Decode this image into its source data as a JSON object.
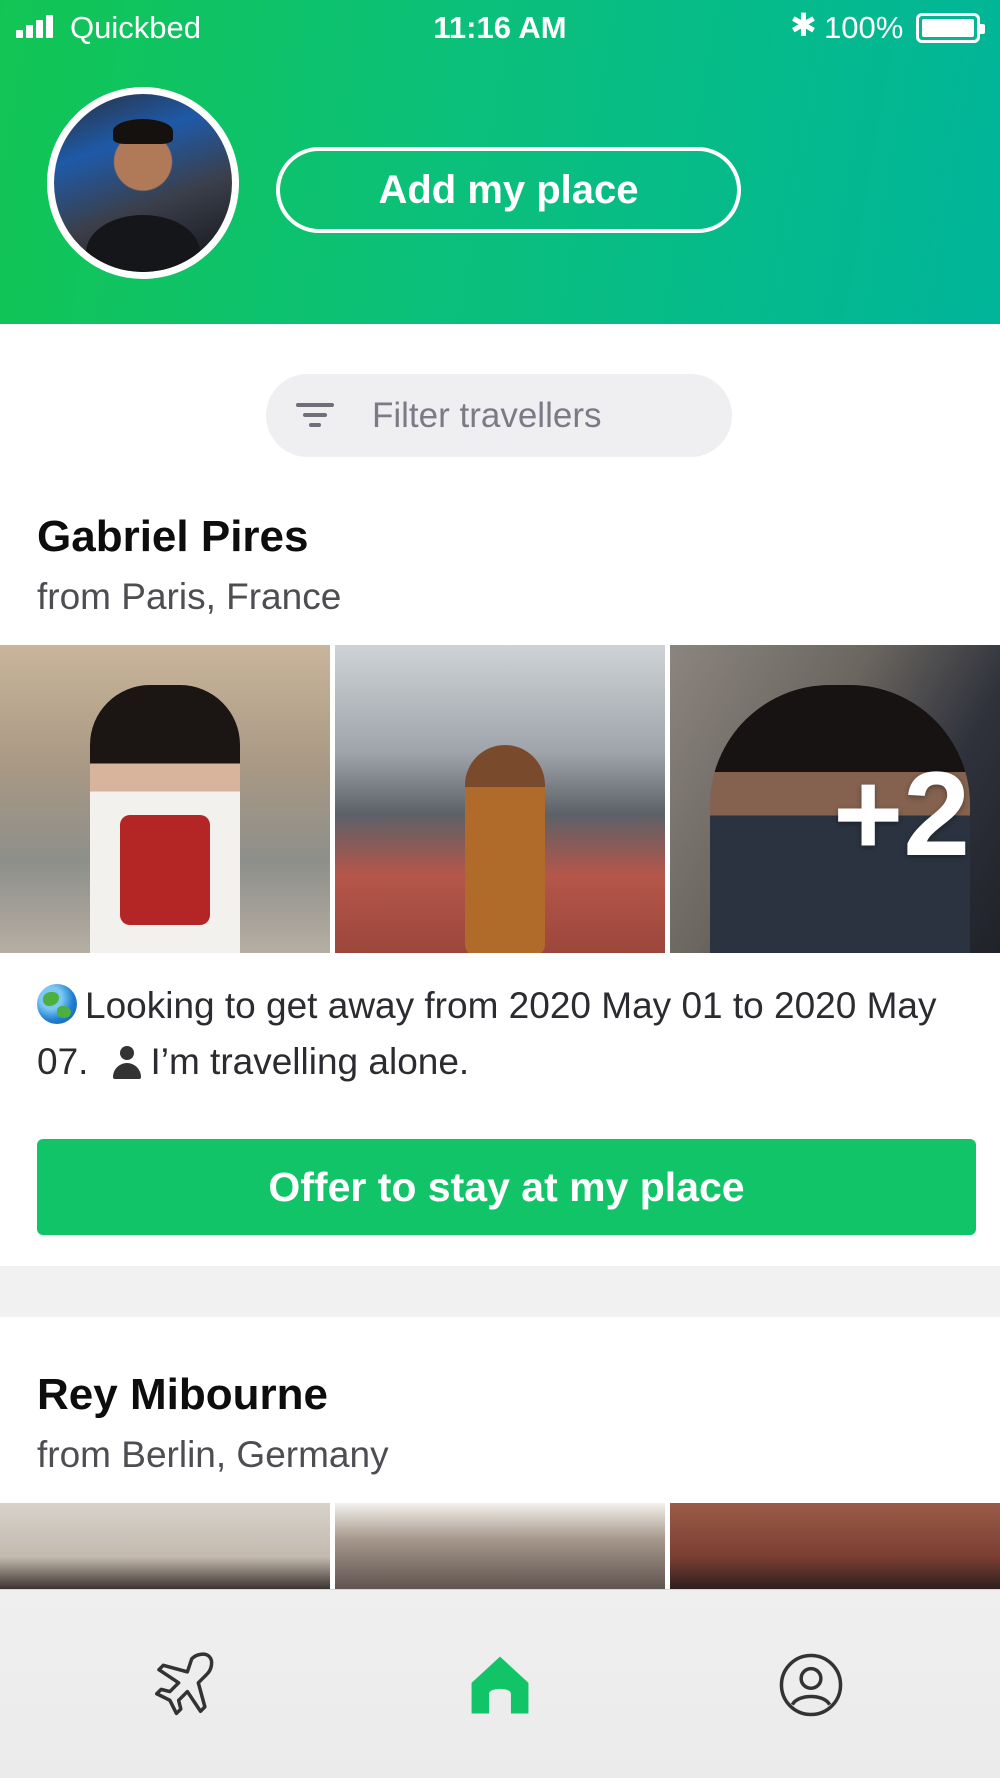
{
  "status_bar": {
    "carrier": "Quickbed",
    "time": "11:16 AM",
    "battery_percent": "100%",
    "battery_level": 1.0,
    "bluetooth_icon": "bluetooth-icon"
  },
  "header": {
    "avatar_icon": "profile-photo",
    "add_place_label": "Add my place"
  },
  "filter": {
    "icon": "filter-icon",
    "label": "Filter travellers"
  },
  "travellers": [
    {
      "name": "Gabriel Pires",
      "origin": "from Paris, France",
      "extra_photos": "+2",
      "description_part1": "Looking to get away from 2020 May 01 to 2020 May 07.",
      "description_part2": "I’m travelling alone.",
      "cta_label": "Offer to stay at my place"
    },
    {
      "name": "Rey Mibourne",
      "origin": "from Berlin, Germany"
    }
  ],
  "tabbar": {
    "items": [
      {
        "icon": "airplane-icon",
        "active": false
      },
      {
        "icon": "home-icon",
        "active": true
      },
      {
        "icon": "profile-icon",
        "active": false
      }
    ],
    "active_color": "#12c468",
    "inactive_color": "#333333"
  },
  "colors": {
    "brand_green": "#12c468",
    "header_gradient_start": "#12c553",
    "header_gradient_end": "#00b59a"
  }
}
